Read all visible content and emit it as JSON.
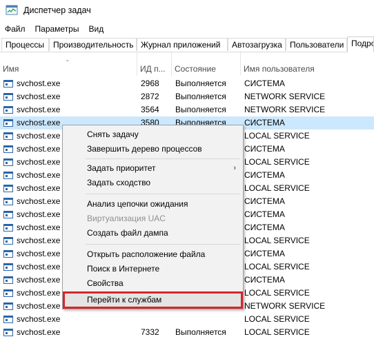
{
  "window": {
    "title": "Диспетчер задач"
  },
  "menu": [
    "Файл",
    "Параметры",
    "Вид"
  ],
  "tabs": [
    {
      "label": "Процессы"
    },
    {
      "label": "Производительность"
    },
    {
      "label": "Журнал приложений"
    },
    {
      "label": "Автозагрузка"
    },
    {
      "label": "Пользователи"
    },
    {
      "label": "Подро"
    }
  ],
  "active_tab_index": 5,
  "columns": {
    "name": "Имя",
    "pid": "ИД п...",
    "state": "Состояние",
    "user": "Имя пользователя"
  },
  "rows": [
    {
      "name": "svchost.exe",
      "pid": "2968",
      "state": "Выполняется",
      "user": "СИСТЕМА"
    },
    {
      "name": "svchost.exe",
      "pid": "2872",
      "state": "Выполняется",
      "user": "NETWORK SERVICE"
    },
    {
      "name": "svchost.exe",
      "pid": "3564",
      "state": "Выполняется",
      "user": "NETWORK SERVICE"
    },
    {
      "name": "svchost.exe",
      "pid": "3580",
      "state": "Выполняется",
      "user": "СИСТЕМА",
      "selected": true
    },
    {
      "name": "svchost.exe",
      "pid": "",
      "state": "",
      "user": "LOCAL SERVICE"
    },
    {
      "name": "svchost.exe",
      "pid": "",
      "state": "",
      "user": "СИСТЕМА"
    },
    {
      "name": "svchost.exe",
      "pid": "",
      "state": "",
      "user": "LOCAL SERVICE"
    },
    {
      "name": "svchost.exe",
      "pid": "",
      "state": "",
      "user": "СИСТЕМА"
    },
    {
      "name": "svchost.exe",
      "pid": "",
      "state": "",
      "user": "LOCAL SERVICE"
    },
    {
      "name": "svchost.exe",
      "pid": "",
      "state": "",
      "user": "СИСТЕМА"
    },
    {
      "name": "svchost.exe",
      "pid": "",
      "state": "",
      "user": "СИСТЕМА"
    },
    {
      "name": "svchost.exe",
      "pid": "",
      "state": "",
      "user": "СИСТЕМА"
    },
    {
      "name": "svchost.exe",
      "pid": "",
      "state": "",
      "user": "LOCAL SERVICE"
    },
    {
      "name": "svchost.exe",
      "pid": "",
      "state": "",
      "user": "СИСТЕМА"
    },
    {
      "name": "svchost.exe",
      "pid": "",
      "state": "",
      "user": "LOCAL SERVICE"
    },
    {
      "name": "svchost.exe",
      "pid": "",
      "state": "",
      "user": "СИСТЕМА"
    },
    {
      "name": "svchost.exe",
      "pid": "",
      "state": "",
      "user": "LOCAL SERVICE"
    },
    {
      "name": "svchost.exe",
      "pid": "",
      "state": "",
      "user": "NETWORK SERVICE"
    },
    {
      "name": "svchost.exe",
      "pid": "",
      "state": "",
      "user": "LOCAL SERVICE"
    },
    {
      "name": "svchost.exe",
      "pid": "7332",
      "state": "Выполняется",
      "user": "LOCAL SERVICE"
    }
  ],
  "context_menu": {
    "items": [
      {
        "label": "Снять задачу",
        "name": "ctx-end-task"
      },
      {
        "label": "Завершить дерево процессов",
        "name": "ctx-end-process-tree"
      },
      {
        "label": "Задать приоритет",
        "name": "ctx-set-priority",
        "submenu": true
      },
      {
        "label": "Задать сходство",
        "name": "ctx-set-affinity"
      },
      {
        "label": "Анализ цепочки ожидания",
        "name": "ctx-analyze-wait-chain"
      },
      {
        "label": "Виртуализация UAC",
        "name": "ctx-uac-virtualization",
        "disabled": true
      },
      {
        "label": "Создать файл дампа",
        "name": "ctx-create-dump-file"
      },
      {
        "label": "Открыть расположение файла",
        "name": "ctx-open-file-location"
      },
      {
        "label": "Поиск в Интернете",
        "name": "ctx-search-online"
      },
      {
        "label": "Свойства",
        "name": "ctx-properties"
      },
      {
        "label": "Перейти к службам",
        "name": "ctx-go-to-services",
        "highlighted": true
      }
    ],
    "submenu_glyph": "›"
  },
  "colors": {
    "selection": "#cce8ff",
    "highlight_outline": "#d3262b",
    "menu_background": "#f2f2f2"
  },
  "icons": {
    "app": "task-manager-icon",
    "process": "process-window-icon",
    "sort": "sort-arrow-icon"
  }
}
